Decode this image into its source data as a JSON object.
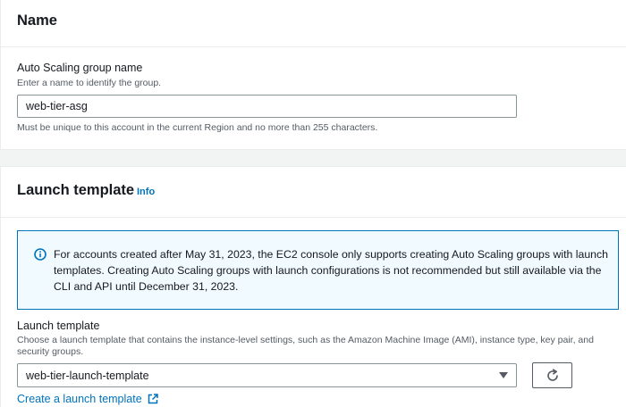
{
  "name_section": {
    "title": "Name",
    "field_label": "Auto Scaling group name",
    "field_description": "Enter a name to identify the group.",
    "field_value": "web-tier-asg",
    "field_constraint": "Must be unique to this account in the current Region and no more than 255 characters."
  },
  "launch_section": {
    "title": "Launch template",
    "info_link": "Info",
    "alert": {
      "icon": "info-circle-icon",
      "text": "For accounts created after May 31, 2023, the EC2 console only supports creating Auto Scaling groups with launch templates. Creating Auto Scaling groups with launch configurations is not recommended but still available via the CLI and API until December 31, 2023."
    },
    "field_label": "Launch template",
    "field_description": "Choose a launch template that contains the instance-level settings, such as the Amazon Machine Image (AMI), instance type, key pair, and security groups.",
    "selected_template": "web-tier-launch-template",
    "refresh_icon": "refresh-icon",
    "create_link": "Create a launch template",
    "create_link_icon": "external-link-icon"
  },
  "colors": {
    "link": "#0073bb",
    "alert_bg": "#f1faff",
    "alert_border": "#0073bb",
    "text": "#16191f",
    "secondary_text": "#545b64",
    "page_bg": "#f2f3f3"
  }
}
